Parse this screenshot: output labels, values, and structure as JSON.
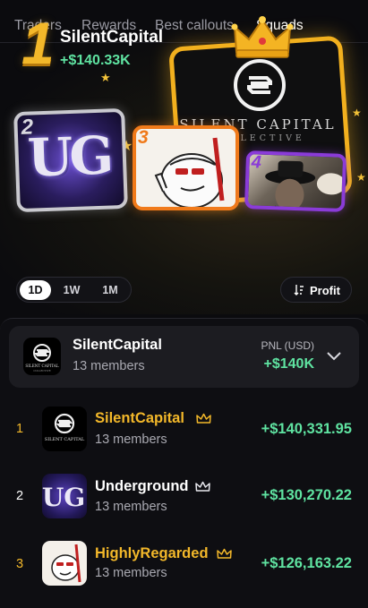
{
  "tabs": [
    {
      "label": "Traders"
    },
    {
      "label": "Rewards"
    },
    {
      "label": "Best callouts"
    },
    {
      "label": "Squads",
      "active": true
    }
  ],
  "hero": {
    "rank": "1",
    "name": "SilentCapital",
    "pnl": "+$140.33K",
    "logo_title": "SILENT CAPITAL",
    "logo_subtitle": "COLLECTIVE",
    "runner_ups": [
      {
        "rank": "2",
        "logo_text": "UG",
        "border_color": "#c9c9cf"
      },
      {
        "rank": "3",
        "border_color": "#f07a1a"
      },
      {
        "rank": "4",
        "border_color": "#8a3bd8"
      }
    ]
  },
  "filters": {
    "periods": [
      "1D",
      "1W",
      "1M"
    ],
    "active_period": "1D",
    "sort_label": "Profit"
  },
  "my_squad": {
    "name": "SilentCapital",
    "members": "13 members",
    "pnl_label": "PNL (USD)",
    "pnl": "+$140K",
    "logo_title": "SILENT CAPITAL",
    "logo_subtitle": "COLLECTIVE"
  },
  "leaderboard": [
    {
      "rank": "1",
      "name": "SilentCapital",
      "members": "13 members",
      "pnl": "+$140,331.95",
      "name_color": "#f3b82a",
      "rank_color": "#f3b82a",
      "crown_color": "#f3b82a",
      "logo_text": "SILENT CAPITAL"
    },
    {
      "rank": "2",
      "name": "Underground",
      "members": "13 members",
      "pnl": "+$130,270.22",
      "name_color": "#ffffff",
      "rank_color": "#ffffff",
      "crown_color": "#e8e8ee",
      "logo_text": "UG"
    },
    {
      "rank": "3",
      "name": "HighlyRegarded",
      "members": "13 members",
      "pnl": "+$126,163.22",
      "name_color": "#f3b82a",
      "rank_color": "#f3b82a",
      "crown_color": "#f3b82a"
    }
  ],
  "colors": {
    "accent_gold": "#f3b82a",
    "pnl_green": "#5fe3a1",
    "background": "#0b0b0e"
  },
  "icons": [
    "crown-icon",
    "star-icon",
    "sort-icon",
    "chevron-down-icon",
    "silent-capital-logo"
  ]
}
